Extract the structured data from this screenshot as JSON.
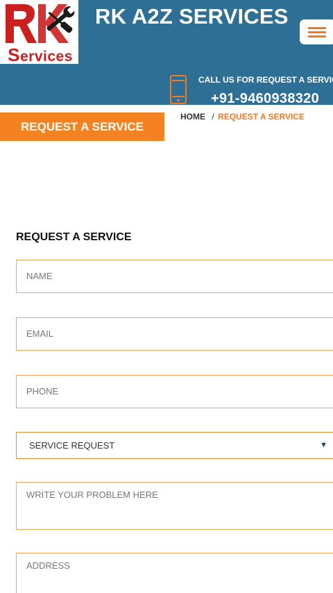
{
  "header": {
    "logo_first": "S",
    "logo_rest": "ervices",
    "logo_mark": "RK",
    "site_title": "RK A2Z SERVICES",
    "call_label": "CALL US FOR REQUEST A SERVICE!",
    "call_number": "+91-9460938320",
    "menu_icon": "hamburger-icon",
    "phone_icon": "mobile-phone-icon"
  },
  "banner": {
    "label": "REQUEST A SERVICE"
  },
  "breadcrumb": {
    "home": "HOME",
    "separator": "/",
    "current": "REQUEST A SERVICE"
  },
  "form": {
    "title": "REQUEST A SERVICE",
    "name_placeholder": "NAME",
    "email_placeholder": "EMAIL",
    "phone_placeholder": "PHONE",
    "service_selected": "SERVICE REQUEST",
    "problem_placeholder": "WRITE YOUR PROBLEM HERE",
    "address_placeholder": "ADDRESS"
  },
  "colors": {
    "header_bg": "#2e6f96",
    "accent": "#f58220",
    "logo_red": "#cc1f1f",
    "field_border": "#f0a45a"
  }
}
